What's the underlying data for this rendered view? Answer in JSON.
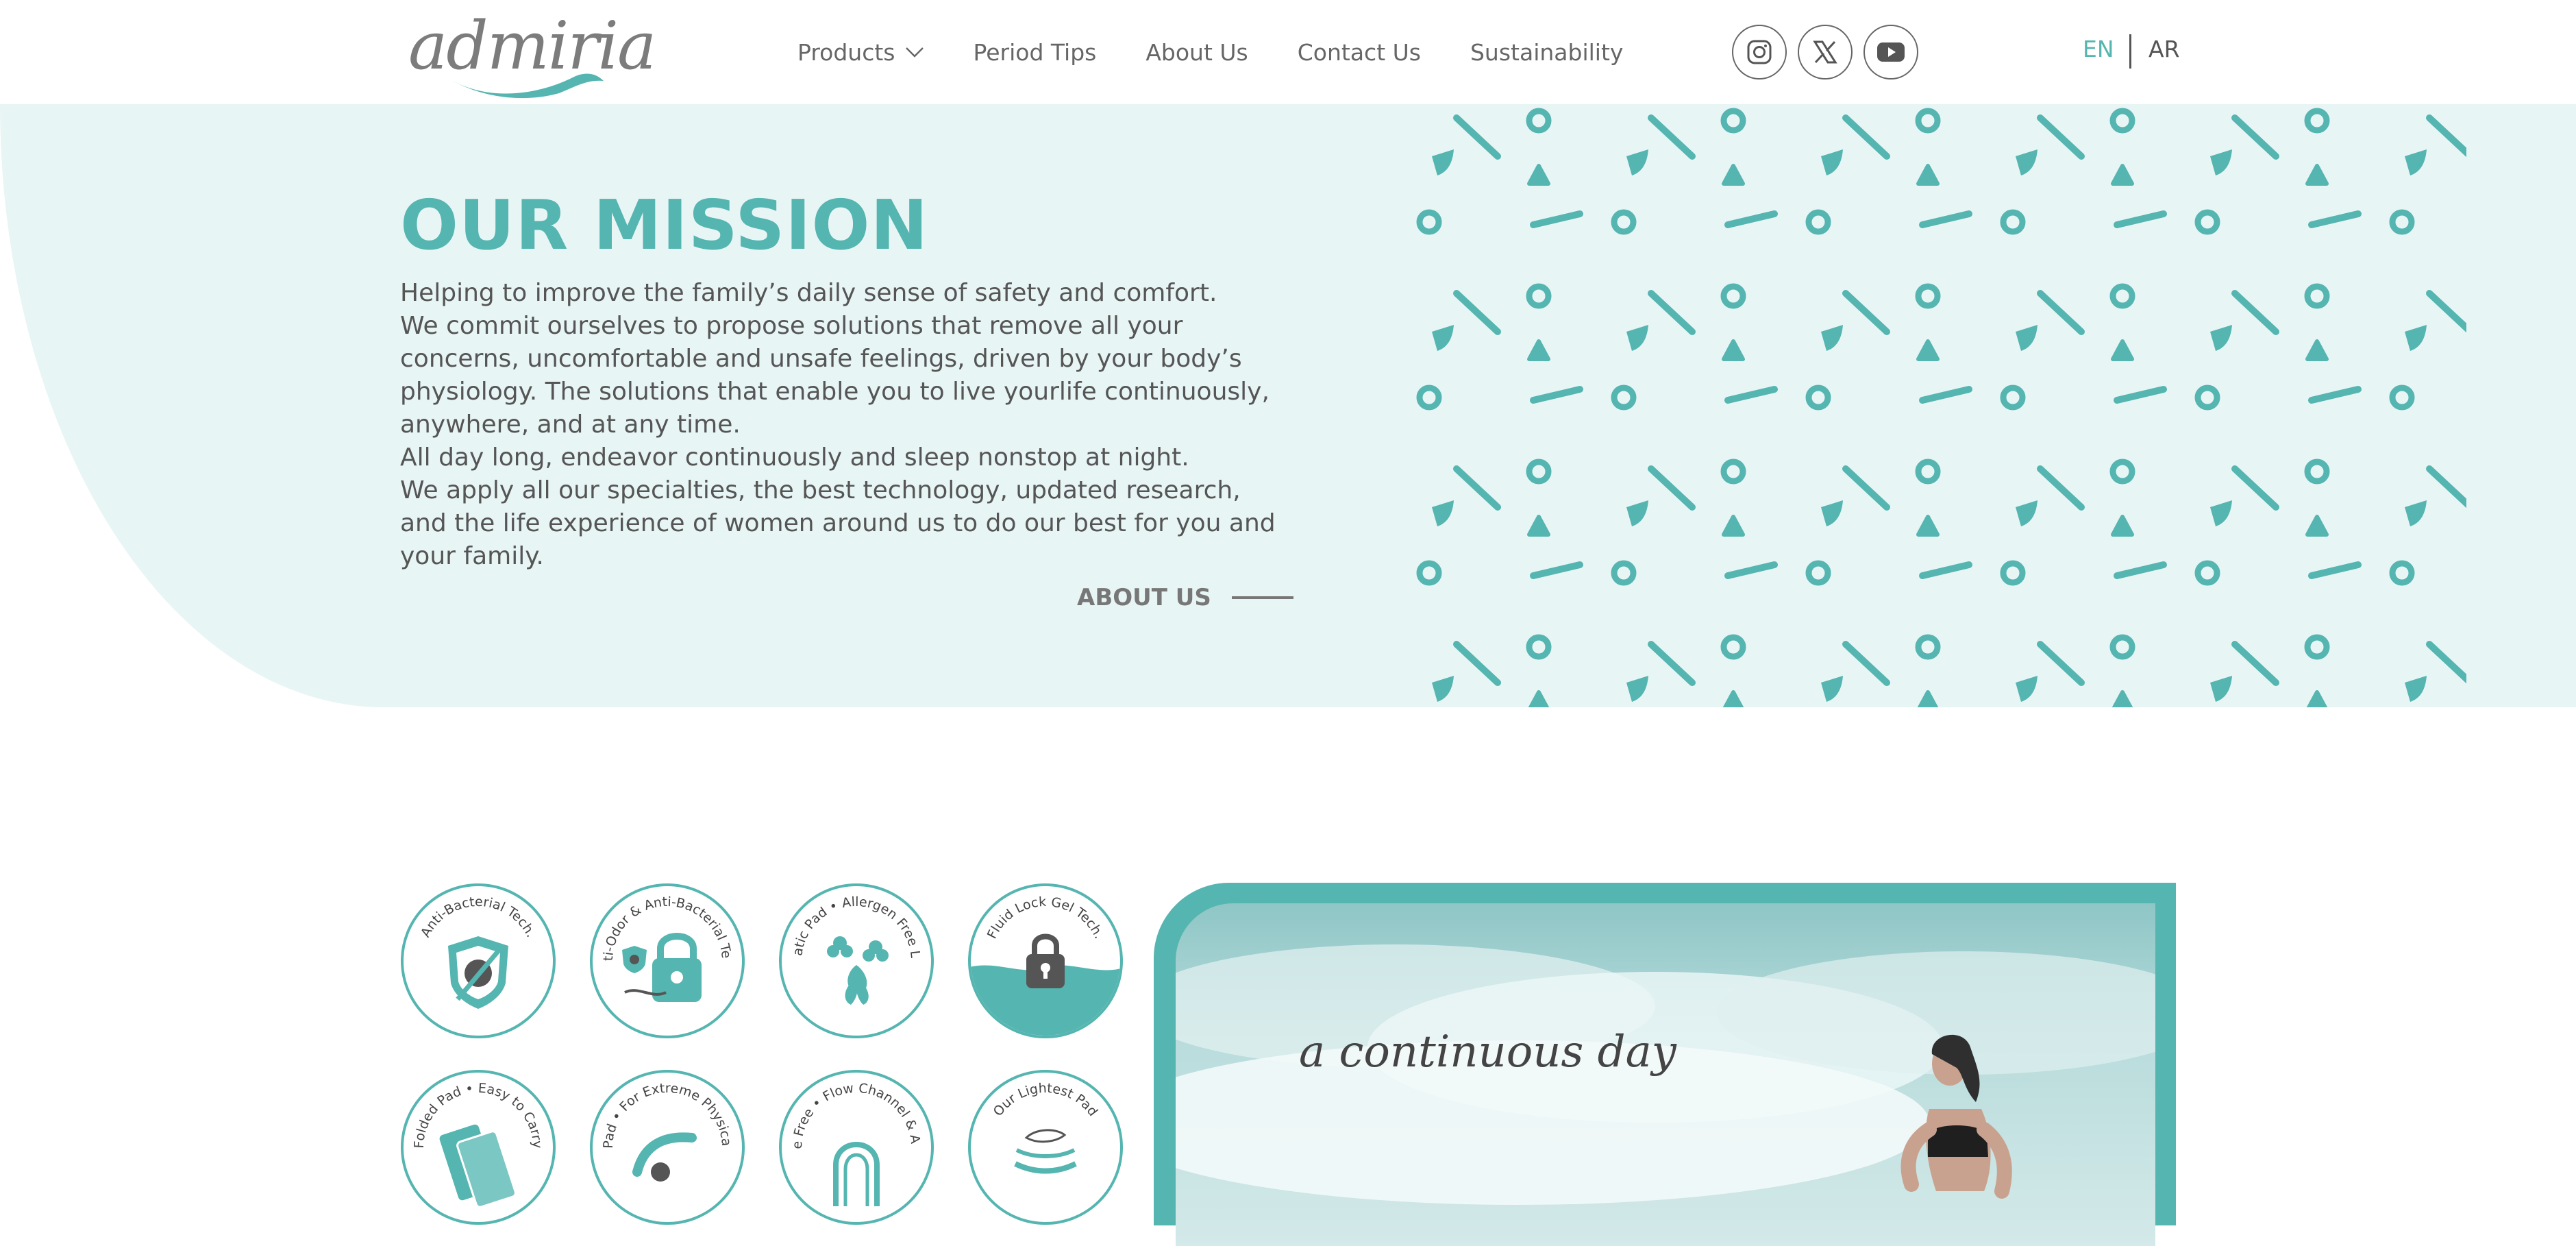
{
  "brand": {
    "logo_text": "admiria"
  },
  "nav": {
    "items": [
      "Products",
      "Period Tips",
      "About Us",
      "Contact Us",
      "Sustainability"
    ]
  },
  "social": [
    "instagram-icon",
    "x-twitter-icon",
    "youtube-icon"
  ],
  "lang": {
    "en": "EN",
    "ar": "AR",
    "active": "EN"
  },
  "colors": {
    "accent": "#55b5b0",
    "bg_mint": "#e8f5f5",
    "text": "#555555"
  },
  "mission": {
    "title": "OUR MISSION",
    "paragraphs": [
      "Helping to improve the family’s daily sense of safety and comfort.",
      "We commit ourselves to propose solutions that remove all your concerns, uncomfortable and unsafe feelings, driven by your body’s physiology. The solutions that enable you to live yourlife continuously, anywhere, and at any time.",
      "All day long, endeavor continuously and sleep nonstop at night.",
      "We apply all our specialties, the best technology, updated research, and the life experience of women around us to do our best for you and your family."
    ],
    "cta": "ABOUT US"
  },
  "badges": [
    "Anti-Bacterial Tech.",
    "Anti-Odor & Anti-Bacterial Tech.",
    "Aromatic Pad • Allergen Free Lotion",
    "Fluid Lock Gel Tech.",
    "Folded Pad • Easy to Carry",
    "Flexible Pad • For Extreme Physical Activity",
    "Leakage Free • Flow Channel & Anti Leak",
    "Our Lightest Pad"
  ],
  "promo": {
    "tagline": "a continuous day"
  }
}
